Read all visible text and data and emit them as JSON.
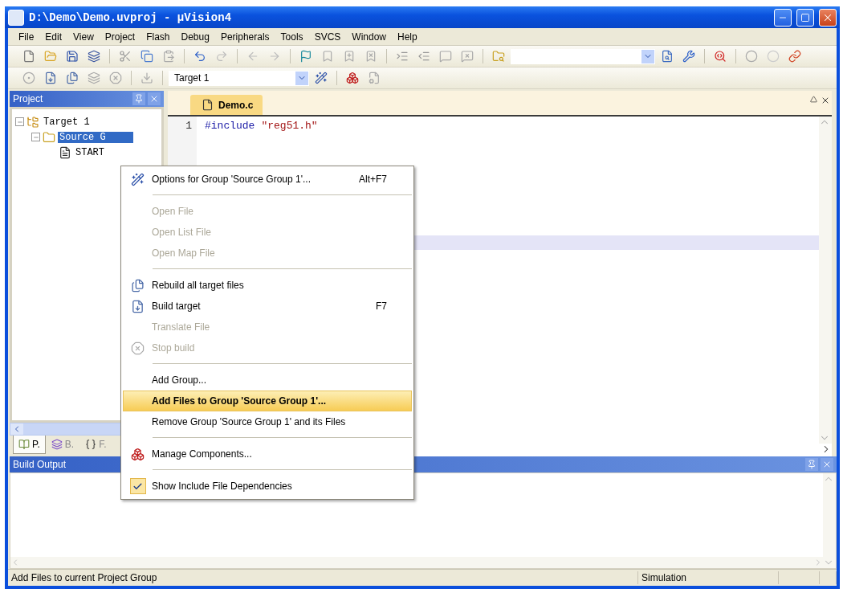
{
  "window": {
    "title": "D:\\Demo\\Demo.uvproj - μVision4"
  },
  "menu_bar": [
    "File",
    "Edit",
    "View",
    "Project",
    "Flash",
    "Debug",
    "Peripherals",
    "Tools",
    "SVCS",
    "Window",
    "Help"
  ],
  "build_toolbar": {
    "target": "Target 1"
  },
  "project_panel": {
    "title": "Project",
    "tree": [
      {
        "label": "Target 1",
        "expanded": true,
        "selected": false,
        "children": [
          {
            "label": "Source G",
            "expanded": true,
            "selected": true,
            "children": [
              {
                "label": "START",
                "selected": false
              }
            ]
          }
        ]
      }
    ],
    "tabs": [
      {
        "label": "P.",
        "selected": true
      },
      {
        "label": "B.",
        "selected": false
      },
      {
        "label": "F.",
        "selected": false
      }
    ]
  },
  "editor": {
    "tabs": [
      {
        "label": "Demo.c",
        "selected": true
      }
    ],
    "lines": [
      {
        "number": "1",
        "tokens": [
          {
            "kind": "directive",
            "text": "#include"
          },
          {
            "kind": "string",
            "text": "\"reg51.h\""
          }
        ]
      }
    ]
  },
  "build_output": {
    "title": "Build Output"
  },
  "context_menu": [
    {
      "kind": "item",
      "label": "Options for Group 'Source Group 1'...",
      "shortcut": "Alt+F7",
      "disabled": false,
      "selected": false,
      "checked": false
    },
    {
      "kind": "separator"
    },
    {
      "kind": "item",
      "label": "Open File",
      "disabled": true,
      "selected": false,
      "checked": false
    },
    {
      "kind": "item",
      "label": "Open List File",
      "disabled": true,
      "selected": false,
      "checked": false
    },
    {
      "kind": "item",
      "label": "Open Map File",
      "disabled": true,
      "selected": false,
      "checked": false
    },
    {
      "kind": "separator"
    },
    {
      "kind": "item",
      "label": "Rebuild all target files",
      "disabled": false,
      "selected": false,
      "checked": false
    },
    {
      "kind": "item",
      "label": "Build target",
      "shortcut": "F7",
      "disabled": false,
      "selected": false,
      "checked": false
    },
    {
      "kind": "item",
      "label": "Translate File",
      "disabled": true,
      "selected": false,
      "checked": false
    },
    {
      "kind": "item",
      "label": "Stop build",
      "disabled": true,
      "selected": false,
      "checked": false
    },
    {
      "kind": "separator"
    },
    {
      "kind": "item",
      "label": "Add Group...",
      "disabled": false,
      "selected": false,
      "checked": false
    },
    {
      "kind": "item",
      "label": "Add Files to Group 'Source Group 1'...",
      "disabled": false,
      "selected": true,
      "checked": false
    },
    {
      "kind": "item",
      "label": "Remove Group 'Source Group 1' and its Files",
      "disabled": false,
      "selected": false,
      "checked": false
    },
    {
      "kind": "separator"
    },
    {
      "kind": "item",
      "label": "Manage Components...",
      "disabled": false,
      "selected": false,
      "checked": false
    },
    {
      "kind": "separator"
    },
    {
      "kind": "item",
      "label": "Show Include File Dependencies",
      "disabled": false,
      "selected": false,
      "checked": true
    }
  ],
  "status_bar": {
    "message": "Add Files to current Project Group",
    "mode": "Simulation"
  }
}
